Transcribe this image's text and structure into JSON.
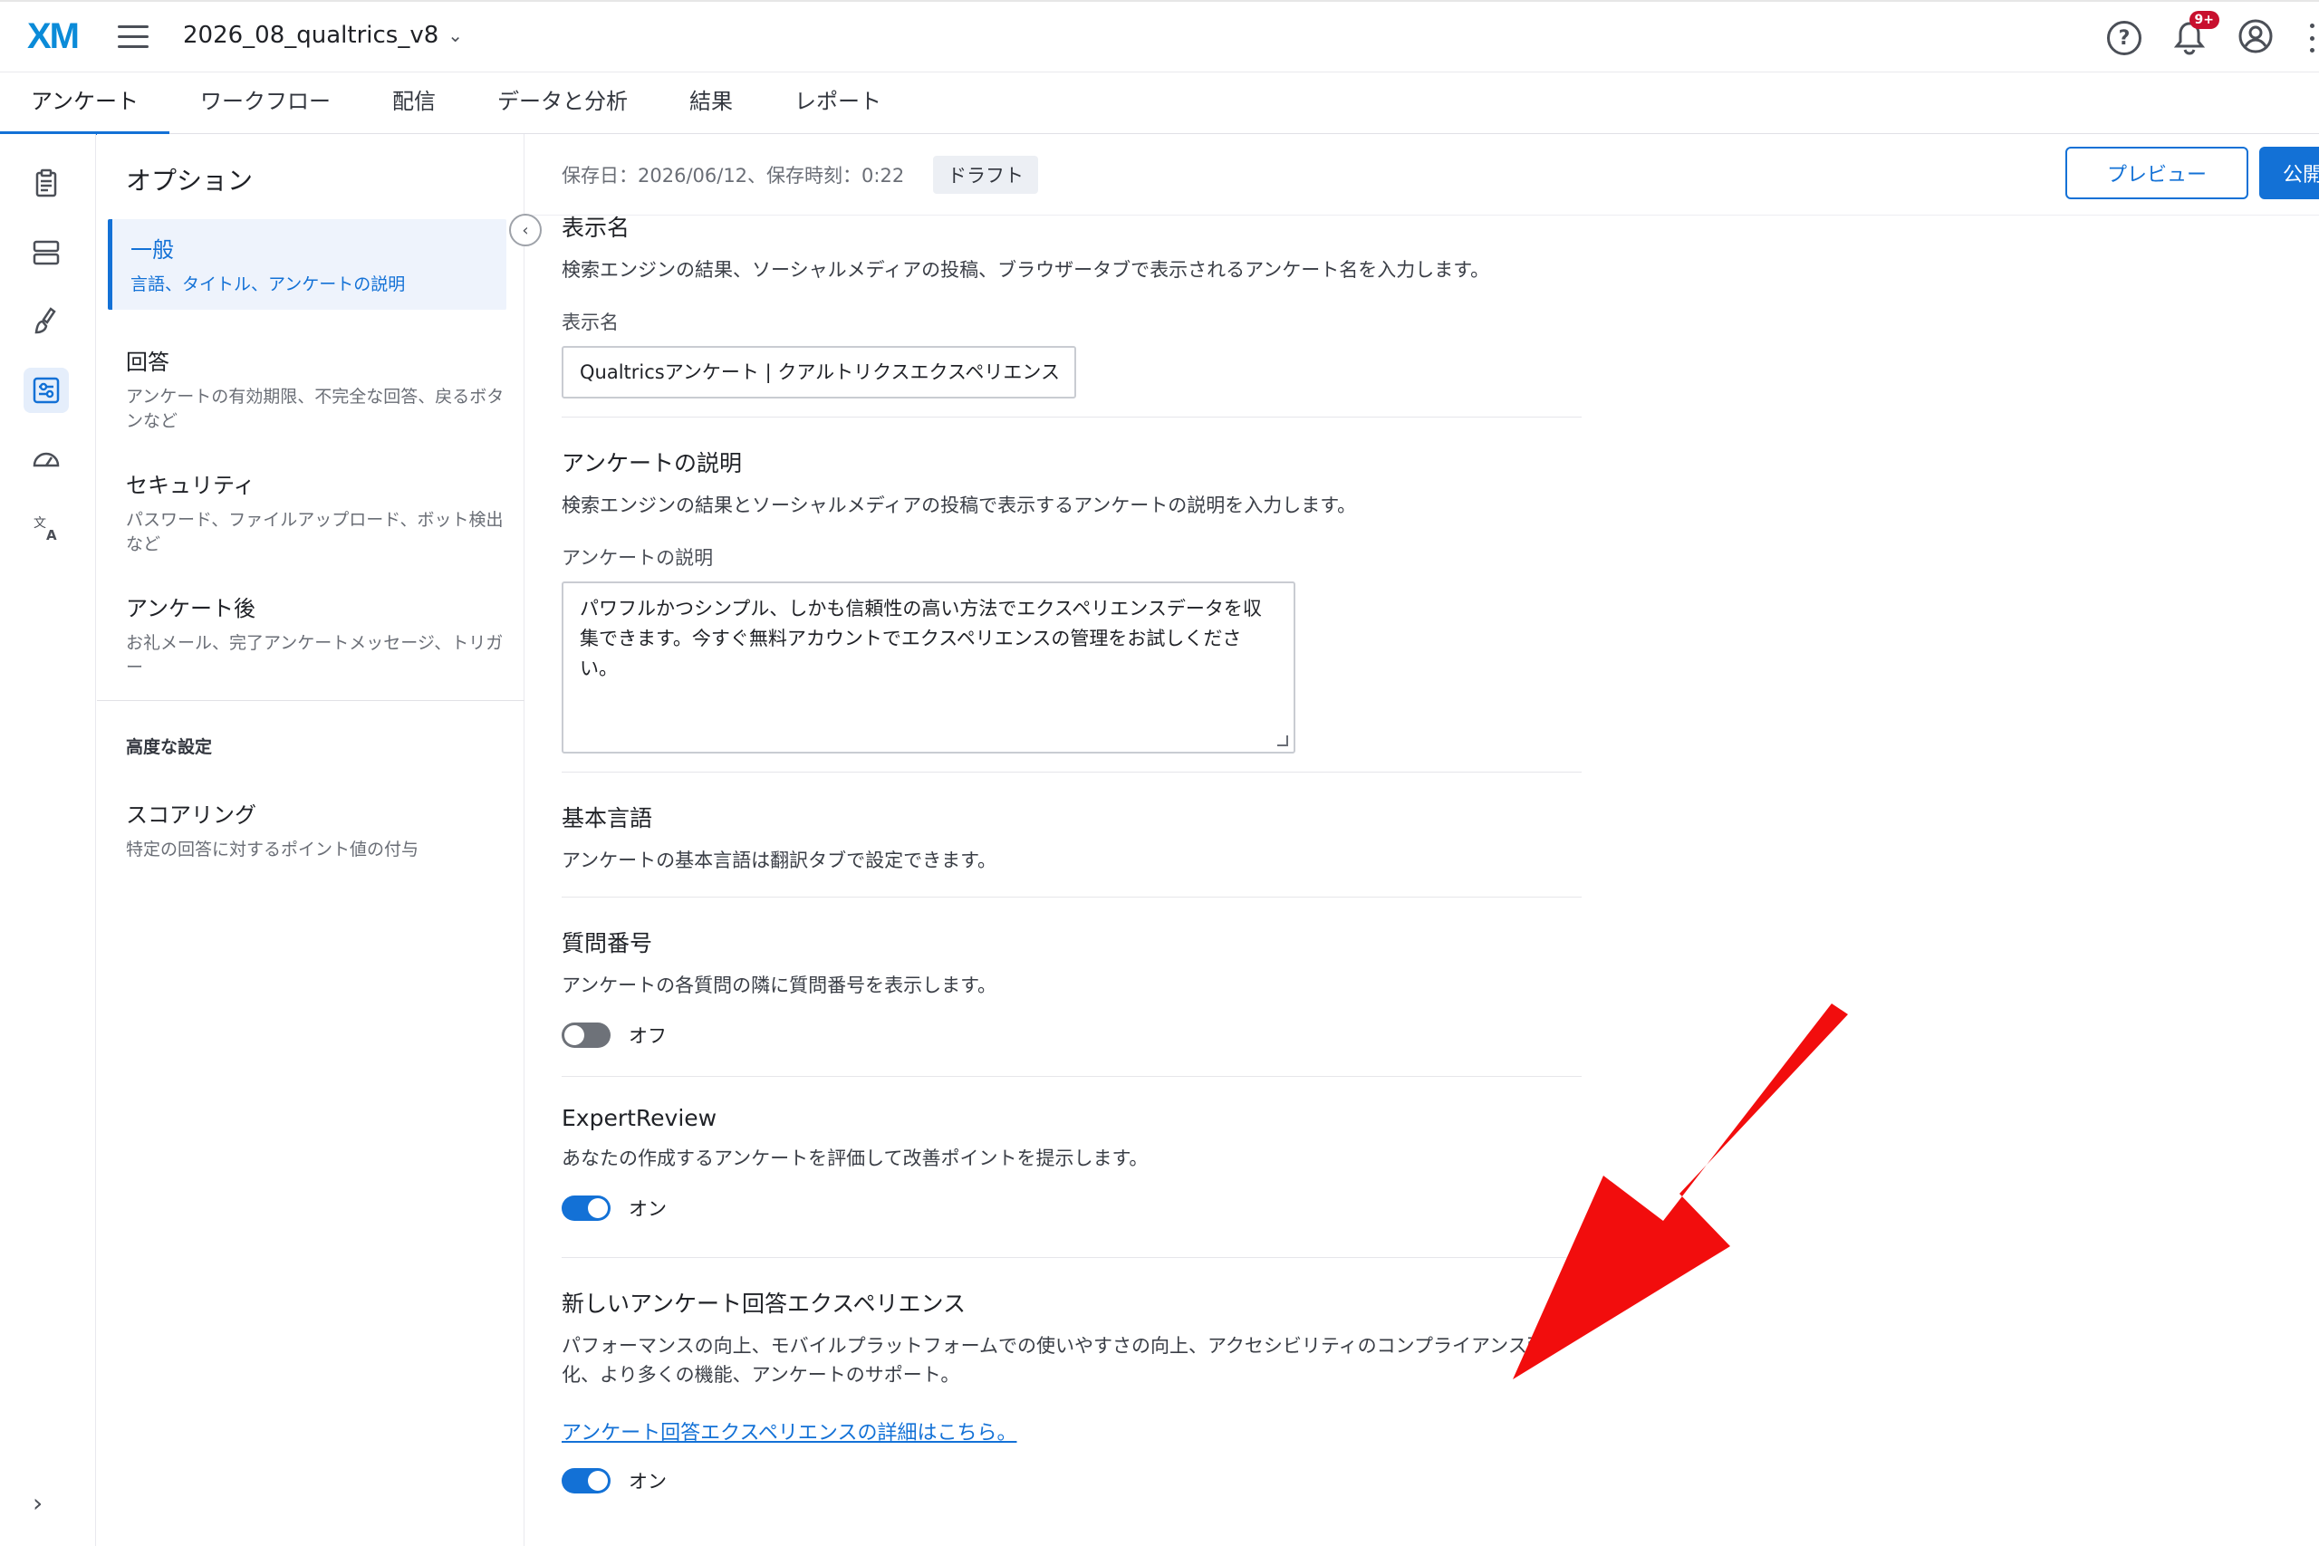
{
  "header": {
    "logo": "XM",
    "project_name": "2026_08_qualtrics_v8",
    "notification_badge": "9+"
  },
  "tabs": [
    {
      "label": "アンケート",
      "active": true
    },
    {
      "label": "ワークフロー"
    },
    {
      "label": "配信"
    },
    {
      "label": "データと分析"
    },
    {
      "label": "結果"
    },
    {
      "label": "レポート"
    }
  ],
  "options": {
    "title": "オプション",
    "items": [
      {
        "title": "一般",
        "desc": "言語、タイトル、アンケートの説明",
        "active": true
      },
      {
        "title": "回答",
        "desc": "アンケートの有効期限、不完全な回答、戻るボタンなど"
      },
      {
        "title": "セキュリティ",
        "desc": "パスワード、ファイルアップロード、ボット検出など"
      },
      {
        "title": "アンケート後",
        "desc": "お礼メール、完了アンケートメッセージ、トリガー"
      }
    ],
    "advanced_label": "高度な設定",
    "advanced_items": [
      {
        "title": "スコアリング",
        "desc": "特定の回答に対するポイント値の付与"
      }
    ]
  },
  "subbar": {
    "saved": "保存日：2026/06/12、保存時刻：0:22",
    "draft": "ドラフト",
    "preview": "プレビュー",
    "publish": "公開"
  },
  "sections": {
    "display_name": {
      "title": "表示名",
      "desc": "検索エンジンの結果、ソーシャルメディアの投稿、ブラウザータブで表示されるアンケート名を入力します。",
      "field_label": "表示名",
      "value": "Qualtricsアンケート | クアルトリクスエクスペリエンス"
    },
    "description": {
      "title": "アンケートの説明",
      "desc": "検索エンジンの結果とソーシャルメディアの投稿で表示するアンケートの説明を入力します。",
      "field_label": "アンケートの説明",
      "value": "パワフルかつシンプル、しかも信頼性の高い方法でエクスペリエンスデータを収集できます。今すぐ無料アカウントでエクスペリエンスの管理をお試しください。"
    },
    "base_language": {
      "title": "基本言語",
      "desc": "アンケートの基本言語は翻訳タブで設定できます。"
    },
    "question_numbers": {
      "title": "質問番号",
      "desc": "アンケートの各質問の隣に質問番号を表示します。",
      "toggle_label": "オフ"
    },
    "expert_review": {
      "title": "ExpertReview",
      "desc": "あなたの作成するアンケートを評価して改善ポイントを提示します。",
      "toggle_label": "オン"
    },
    "new_experience": {
      "title": "新しいアンケート回答エクスペリエンス",
      "desc": "パフォーマンスの向上、モバイルプラットフォームでの使いやすさの向上、アクセシビリティのコンプライアンス強化、より多くの機能、アンケートのサポート。",
      "link": "アンケート回答エクスペリエンスの詳細はこちら。",
      "toggle_label": "オン"
    }
  },
  "colors": {
    "accent": "#1371d6",
    "annotation_arrow": "#f20d0d"
  }
}
